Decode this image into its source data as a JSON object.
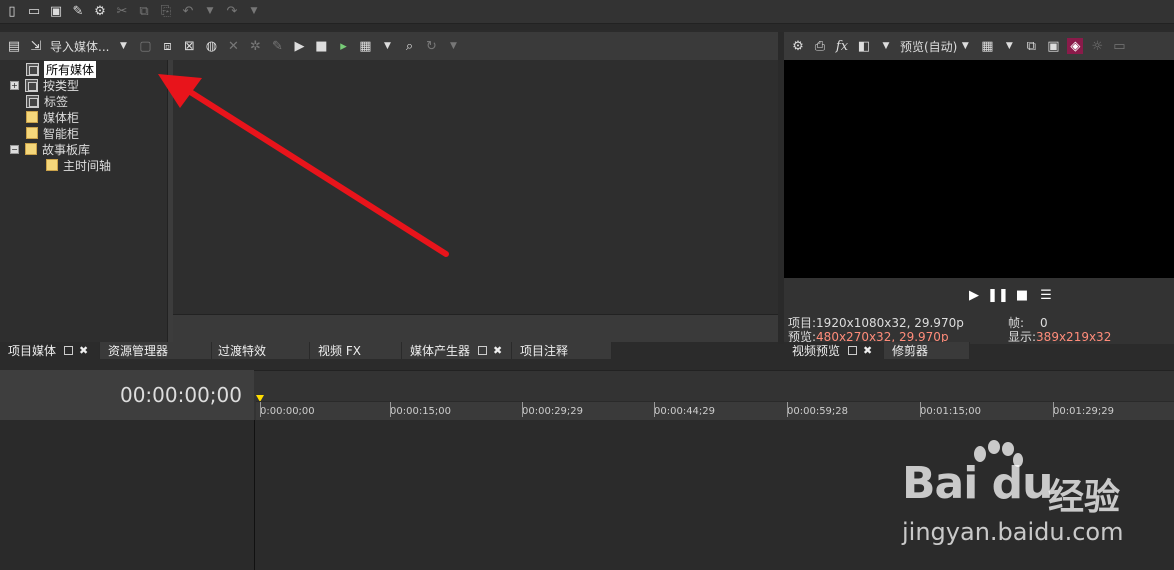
{
  "top_toolbar": {
    "icons": [
      "new-file-icon",
      "open-folder-icon",
      "save-icon",
      "render-icon",
      "settings-icon",
      "cut-icon",
      "copy-icon",
      "paste-icon",
      "undo-icon",
      "dropdown-icon",
      "redo-icon",
      "dropdown-icon"
    ]
  },
  "project_media": {
    "toolbar": {
      "import_label": "导入媒体..."
    },
    "tree": {
      "items": [
        {
          "label": "所有媒体",
          "selected": true
        },
        {
          "label": "按类型",
          "expand": "+"
        },
        {
          "label": "标签"
        },
        {
          "label": "媒体柜"
        },
        {
          "label": "智能柜"
        },
        {
          "label": "故事板库",
          "expand": "-"
        },
        {
          "label": "主时间轴"
        }
      ]
    }
  },
  "left_tabs": [
    {
      "label": "项目媒体",
      "active": true
    },
    {
      "label": "资源管理器"
    },
    {
      "label": "过渡特效"
    },
    {
      "label": "视频 FX"
    },
    {
      "label": "媒体产生器"
    },
    {
      "label": "项目注释"
    }
  ],
  "preview": {
    "toolbar": {
      "quality_label": "预览(自动)"
    },
    "info": {
      "project_label": "项目:",
      "project_value": "1920x1080x32, 29.970p",
      "preview_label": "预览:",
      "preview_value": "480x270x32, 29.970p",
      "frame_label": "帧:",
      "frame_value": "0",
      "display_label": "显示:",
      "display_value": "389x219x32"
    }
  },
  "right_tabs": [
    {
      "label": "视频预览",
      "active": true
    },
    {
      "label": "修剪器"
    }
  ],
  "timeline": {
    "timecode": "00:00:00;00",
    "ruler": [
      "0:00:00;00",
      "00:00:15;00",
      "00:00:29;29",
      "00:00:44;29",
      "00:00:59;28",
      "00:01:15;00",
      "00:01:29;29"
    ]
  },
  "watermark": {
    "logo": "Bai du",
    "jingyan": "经验",
    "url": "jingyan.baidu.com"
  },
  "colors": {
    "accent_red": "#ff8c7a",
    "arrow": "#e8141b",
    "playhead": "#ffdd00"
  }
}
